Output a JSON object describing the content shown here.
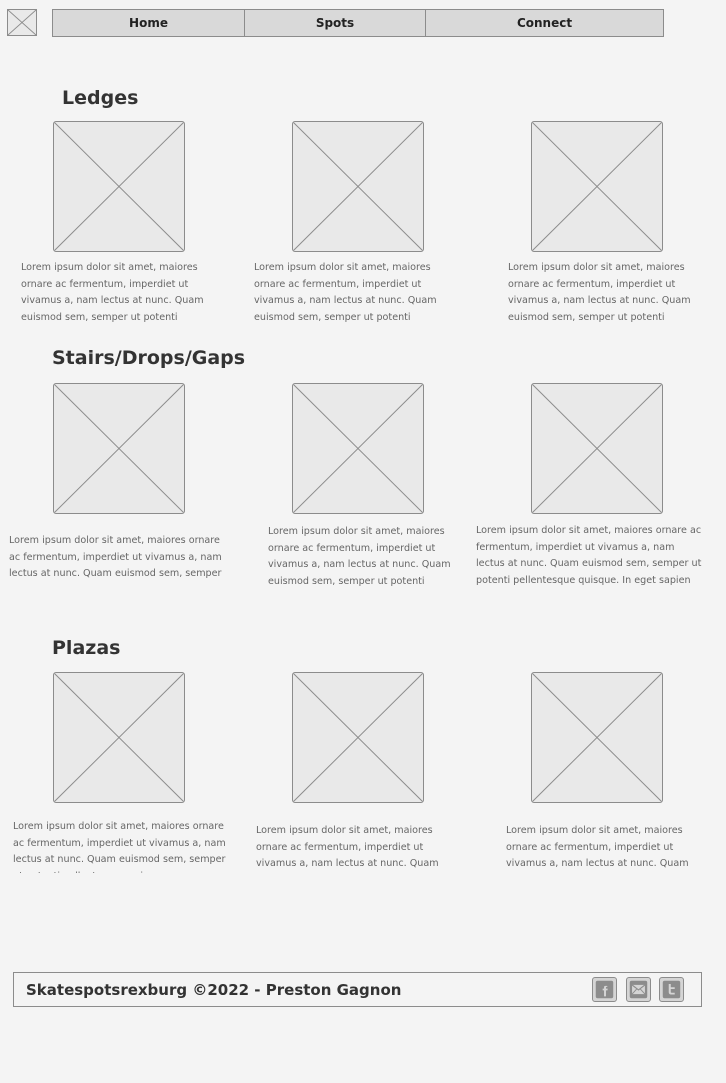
{
  "nav": {
    "items": [
      {
        "label": "Home"
      },
      {
        "label": "Spots"
      },
      {
        "label": "Connect"
      }
    ]
  },
  "sections": {
    "ledges": {
      "title": "Ledges",
      "descriptions": [
        "Lorem ipsum dolor sit amet, maiores ornare ac fermentum, imperdiet ut vivamus a, nam lectus at nunc. Quam euismod sem, semper ut potenti",
        "Lorem ipsum dolor sit amet, maiores ornare ac fermentum, imperdiet ut vivamus a, nam lectus at nunc. Quam euismod sem, semper ut potenti",
        "Lorem ipsum dolor sit amet, maiores ornare ac fermentum, imperdiet ut vivamus a, nam lectus at nunc. Quam euismod sem, semper ut potenti"
      ]
    },
    "stairs": {
      "title": "Stairs/Drops/Gaps",
      "descriptions": [
        "Lorem ipsum dolor sit amet, maiores ornare ac fermentum, imperdiet ut vivamus a, nam lectus at nunc. Quam euismod sem, semper",
        "Lorem ipsum dolor sit amet, maiores ornare ac fermentum, imperdiet ut vivamus a, nam lectus at nunc. Quam euismod sem, semper ut potenti",
        "Lorem ipsum dolor sit amet, maiores ornare ac fermentum, imperdiet ut vivamus a, nam lectus at nunc. Quam euismod sem, semper ut potenti pellentesque quisque. In eget sapien"
      ]
    },
    "plazas": {
      "title": "Plazas",
      "descriptions": [
        "Lorem ipsum dolor sit amet, maiores ornare ac fermentum, imperdiet ut vivamus a, nam lectus at nunc. Quam euismod sem, semper ut potenti pellentesque quisque",
        "Lorem ipsum dolor sit amet, maiores ornare ac fermentum, imperdiet ut vivamus a, nam lectus at nunc. Quam",
        "Lorem ipsum dolor sit amet, maiores ornare ac fermentum, imperdiet ut vivamus a, nam lectus at nunc. Quam"
      ]
    }
  },
  "footer": {
    "text": "Skatespotsrexburg ©2022 - Preston Gagnon",
    "social_icons": [
      "facebook-icon",
      "mail-icon",
      "twitter-icon"
    ]
  }
}
